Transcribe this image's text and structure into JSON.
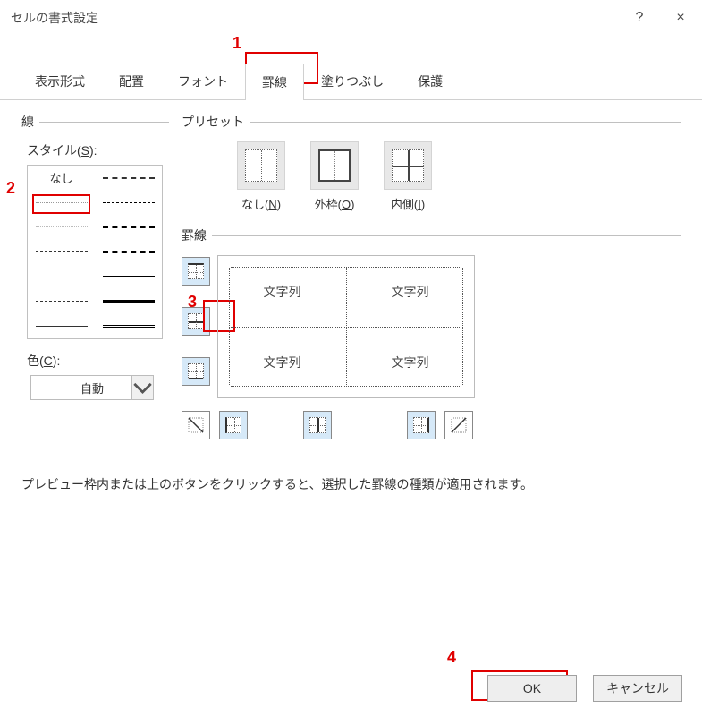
{
  "title": "セルの書式設定",
  "help_icon": "?",
  "close_icon": "×",
  "tabs": [
    "表示形式",
    "配置",
    "フォント",
    "罫線",
    "塗りつぶし",
    "保護"
  ],
  "selected_tab": 3,
  "line_section_label": "線",
  "style_label": "スタイル(S):",
  "style_none": "なし",
  "color_label": "色(C):",
  "color_value": "自動",
  "preset_section_label": "プリセット",
  "presets": [
    {
      "label": "なし(N)",
      "key": "none"
    },
    {
      "label": "外枠(O)",
      "key": "outer"
    },
    {
      "label": "内側(I)",
      "key": "inner"
    }
  ],
  "border_section_label": "罫線",
  "preview_cells": [
    "文字列",
    "文字列",
    "文字列",
    "文字列"
  ],
  "description": "プレビュー枠内または上のボタンをクリックすると、選択した罫線の種類が適用されます。",
  "ok_label": "OK",
  "cancel_label": "キャンセル",
  "annotations": {
    "a1": "1",
    "a2": "2",
    "a3": "3",
    "a4": "4"
  }
}
